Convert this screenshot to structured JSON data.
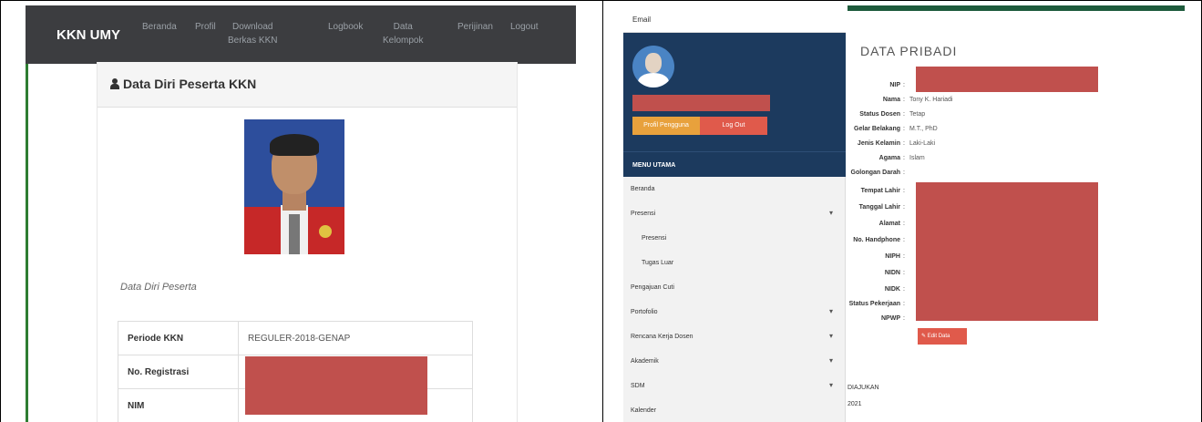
{
  "left": {
    "brand": "KKN UMY",
    "nav": [
      {
        "line1": "Beranda",
        "line2": ""
      },
      {
        "line1": "Profil",
        "line2": ""
      },
      {
        "line1": "Download",
        "line2": "Berkas KKN"
      },
      {
        "line1": "Logbook",
        "line2": ""
      },
      {
        "line1": "Data",
        "line2": "Kelompok"
      },
      {
        "line1": "Perijinan",
        "line2": ""
      },
      {
        "line1": "Logout",
        "line2": ""
      }
    ],
    "card_title": "Data Diri Peserta KKN",
    "caption": "Data Diri Peserta",
    "rows": [
      {
        "key": "Periode KKN",
        "value": "REGULER-2018-GENAP"
      },
      {
        "key": "No. Registrasi",
        "value": ""
      },
      {
        "key": "NIM",
        "value": ""
      }
    ]
  },
  "right": {
    "email_label": "Email",
    "btn_profile": "Profil Pengguna",
    "btn_logout": "Log Out",
    "menu_header": "MENU UTAMA",
    "menu": [
      {
        "label": "Beranda",
        "sub": false,
        "chevron": false
      },
      {
        "label": "Presensi",
        "sub": false,
        "chevron": true
      },
      {
        "label": "Presensi",
        "sub": true,
        "chevron": false
      },
      {
        "label": "Tugas Luar",
        "sub": true,
        "chevron": false
      },
      {
        "label": "Pengajuan Cuti",
        "sub": false,
        "chevron": false
      },
      {
        "label": "Portofolio",
        "sub": false,
        "chevron": true
      },
      {
        "label": "Rencana Kerja Dosen",
        "sub": false,
        "chevron": true
      },
      {
        "label": "Akademik",
        "sub": false,
        "chevron": true
      },
      {
        "label": "SDM",
        "sub": false,
        "chevron": true
      },
      {
        "label": "Kalender",
        "sub": false,
        "chevron": false
      }
    ],
    "title": "DATA PRIBADI",
    "fields": [
      {
        "label": "NIP",
        "value": ""
      },
      {
        "label": "Nama",
        "value": "Tony K. Hariadi"
      },
      {
        "label": "Status Dosen",
        "value": "Tetap"
      },
      {
        "label": "Gelar Belakang",
        "value": "M.T., PhD"
      },
      {
        "label": "Jenis Kelamin",
        "value": "Laki-Laki"
      },
      {
        "label": "Agama",
        "value": "Islam"
      },
      {
        "label": "Golongan Darah",
        "value": ""
      },
      {
        "label": "Tempat Lahir",
        "value": ""
      },
      {
        "label": "Tanggal Lahir",
        "value": ""
      },
      {
        "label": "Alamat",
        "value": ""
      },
      {
        "label": "No. Handphone",
        "value": ""
      },
      {
        "label": "NIPH",
        "value": ""
      },
      {
        "label": "NIDN",
        "value": ""
      },
      {
        "label": "NIDK",
        "value": ""
      },
      {
        "label": "Status Pekerjaan",
        "value": ""
      },
      {
        "label": "NPWP",
        "value": ""
      }
    ],
    "edit_button": "Edit Data",
    "foot1": "DIAJUKAN",
    "foot2": "2021"
  }
}
